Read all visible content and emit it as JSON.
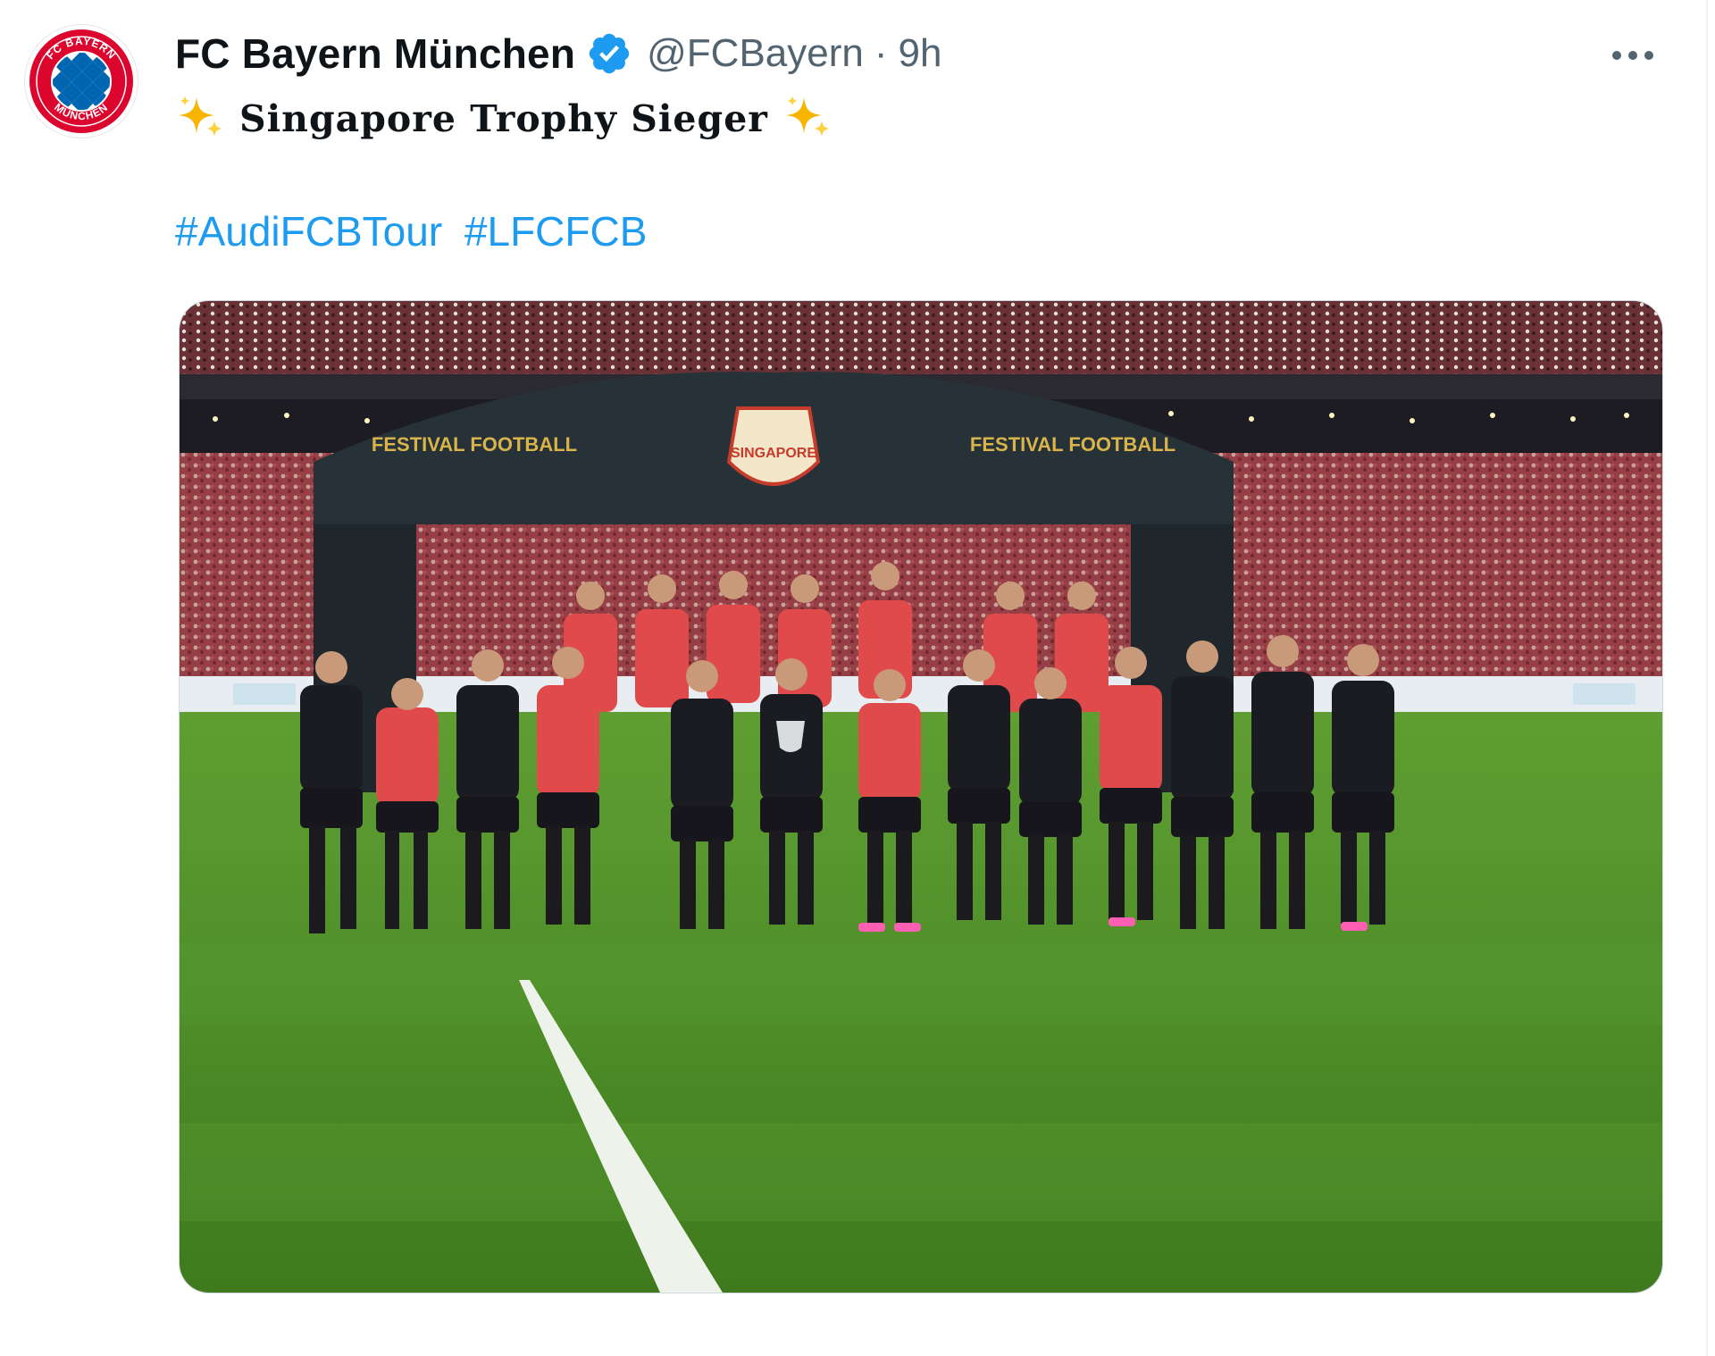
{
  "tweet": {
    "avatar_icon": "fc-bayern-crest-icon",
    "display_name": "FC Bayern München",
    "verified_icon": "verified-badge-icon",
    "handle": "@FCBayern",
    "separator": "·",
    "timestamp": "9h",
    "more_icon": "more-options-icon",
    "text_leading_icon": "sparkles-icon",
    "text": "Singapore Trophy Sieger",
    "text_trailing_icon": "sparkles-icon",
    "hashtags": [
      "#AudiFCBTour",
      "#LFCFCB"
    ],
    "media": {
      "description_icon": "team-photo-image",
      "arch_left_text": "FESTIVAL FOOTBALL",
      "arch_center_text": "SINGAPORE",
      "arch_right_text": "FESTIVAL FOOTBALL"
    }
  },
  "colors": {
    "link": "#1d9bf0",
    "verified": "#1d9bf0",
    "secondary_text": "#536471",
    "primary_text": "#0f1419",
    "bayern_red": "#dc052d",
    "bayern_blue": "#0066b2"
  }
}
